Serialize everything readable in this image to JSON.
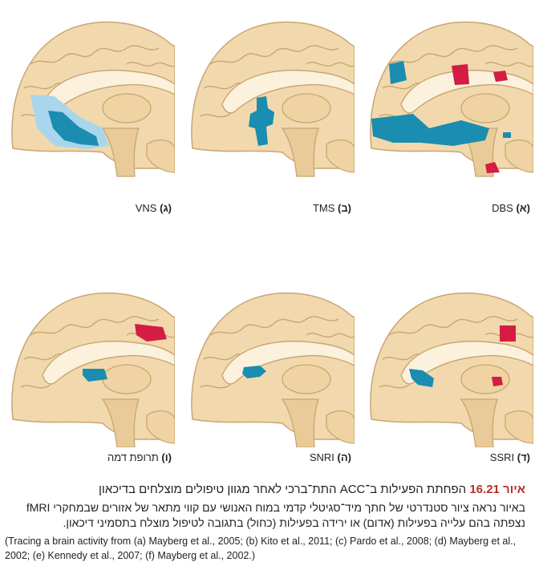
{
  "panels": [
    {
      "label": "(א)",
      "name": "DBS"
    },
    {
      "label": "(ב)",
      "name": "TMS"
    },
    {
      "label": "(ג)",
      "name": "VNS"
    },
    {
      "label": "(ד)",
      "name": "SSRI"
    },
    {
      "label": "(ה)",
      "name": "SNRI"
    },
    {
      "label": "(ו)",
      "name": "תרופת דמה"
    }
  ],
  "figure": {
    "number": "איור 16.21",
    "title": "הפחתת הפעילות ב־ACC התת־ברכי לאחר מגוון טיפולים מוצלחים בדיכאון",
    "description": "באיור נראה ציור סטנדרטי של חתך מיד־סגיטלי קדמי במוח האנושי עם קווי מתאר של אזורים שבמחקרי fMRI נצפתה בהם עלייה בפעילות (אדום) או ירידה בפעילות (כחול) בתגובה לטיפול מוצלח בתסמיני דיכאון.",
    "source": "(Tracing a brain activity from (a) Mayberg et al., 2005; (b) Kito et al., 2011; (c) Pardo et al., 2008; (d) Mayberg et al., 2002; (e) Kennedy et al., 2007; (f) Mayberg et al., 2002.)"
  },
  "colors": {
    "brain": "#f1d9ad",
    "outline": "#c9a572",
    "decrease": "#1a8db0",
    "increase": "#d41c45",
    "light_decrease": "#a9d6ec"
  }
}
